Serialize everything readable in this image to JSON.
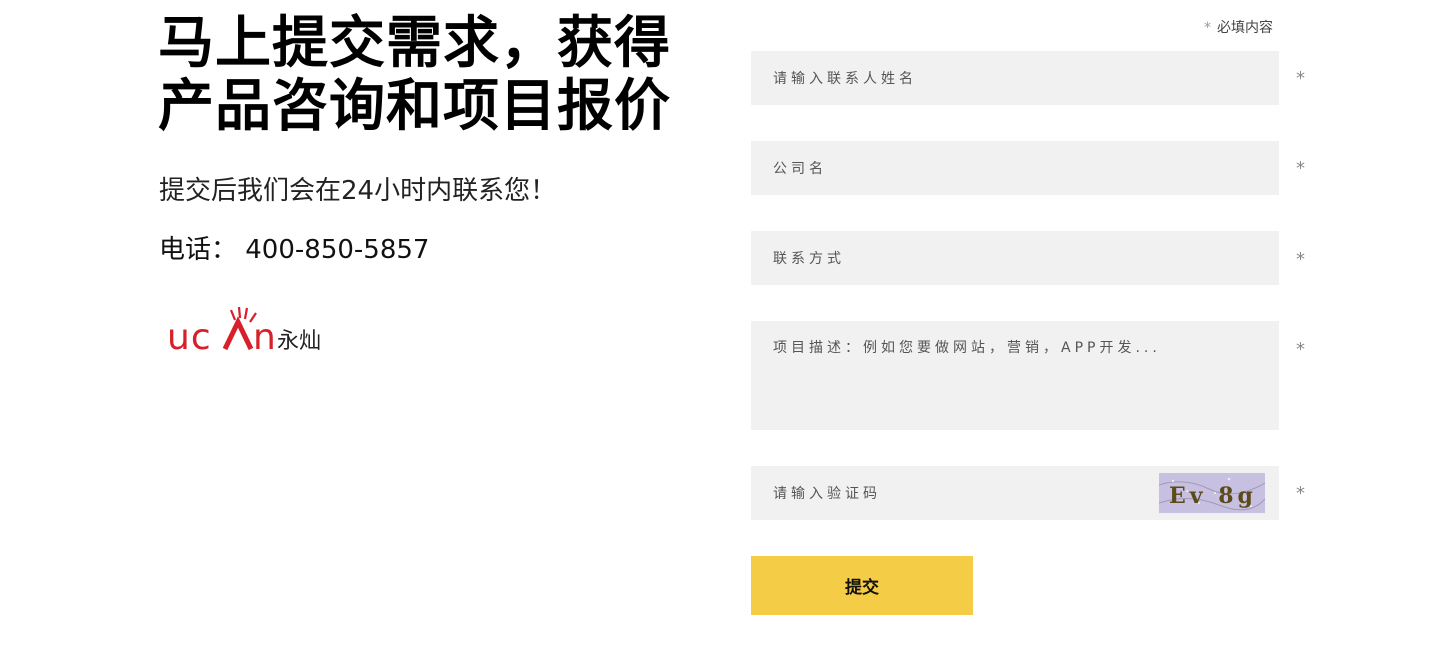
{
  "headline": "马上提交需求，获得产品咨询和项目报价",
  "subtitle": "提交后我们会在24小时内联系您！",
  "phone": "电话： 400-850-5857",
  "logo": {
    "wordmark": "ucAn",
    "chinese": "永灿",
    "brand_color": "#d7202a"
  },
  "form": {
    "required_star": "*",
    "required_note": "必填内容",
    "name_placeholder": "请输入联系人姓名",
    "company_placeholder": "公司名",
    "contact_placeholder": "联系方式",
    "description_placeholder": "项目描述：例如您要做网站，营销，APP开发...",
    "captcha_placeholder": "请输入验证码",
    "captcha_text": "Ev 8g",
    "submit_label": "提交"
  },
  "colors": {
    "submit_bg": "#f5cc45",
    "field_bg": "#f1f1f1"
  }
}
